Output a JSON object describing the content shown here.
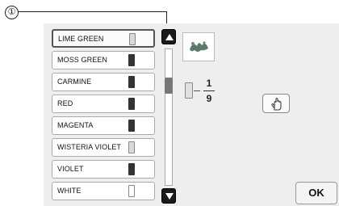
{
  "callout": {
    "number": "①"
  },
  "thread_list": [
    {
      "name": "LIME GREEN",
      "spool": "light",
      "selected": true
    },
    {
      "name": "MOSS GREEN",
      "spool": "dark",
      "selected": false
    },
    {
      "name": "CARMINE",
      "spool": "dark",
      "selected": false
    },
    {
      "name": "RED",
      "spool": "dark",
      "selected": false
    },
    {
      "name": "MAGENTA",
      "spool": "dark",
      "selected": false
    },
    {
      "name": "WISTERIA VIOLET",
      "spool": "light",
      "selected": false
    },
    {
      "name": "VIOLET",
      "spool": "dark",
      "selected": false
    },
    {
      "name": "WHITE",
      "spool": "white",
      "selected": false
    }
  ],
  "scrollbar": {
    "up_icon": "triangle-up-icon",
    "down_icon": "triangle-down-icon"
  },
  "counter": {
    "current": "1",
    "total": "9"
  },
  "buttons": {
    "hand_icon": "hand-icon",
    "ok_label": "OK"
  }
}
